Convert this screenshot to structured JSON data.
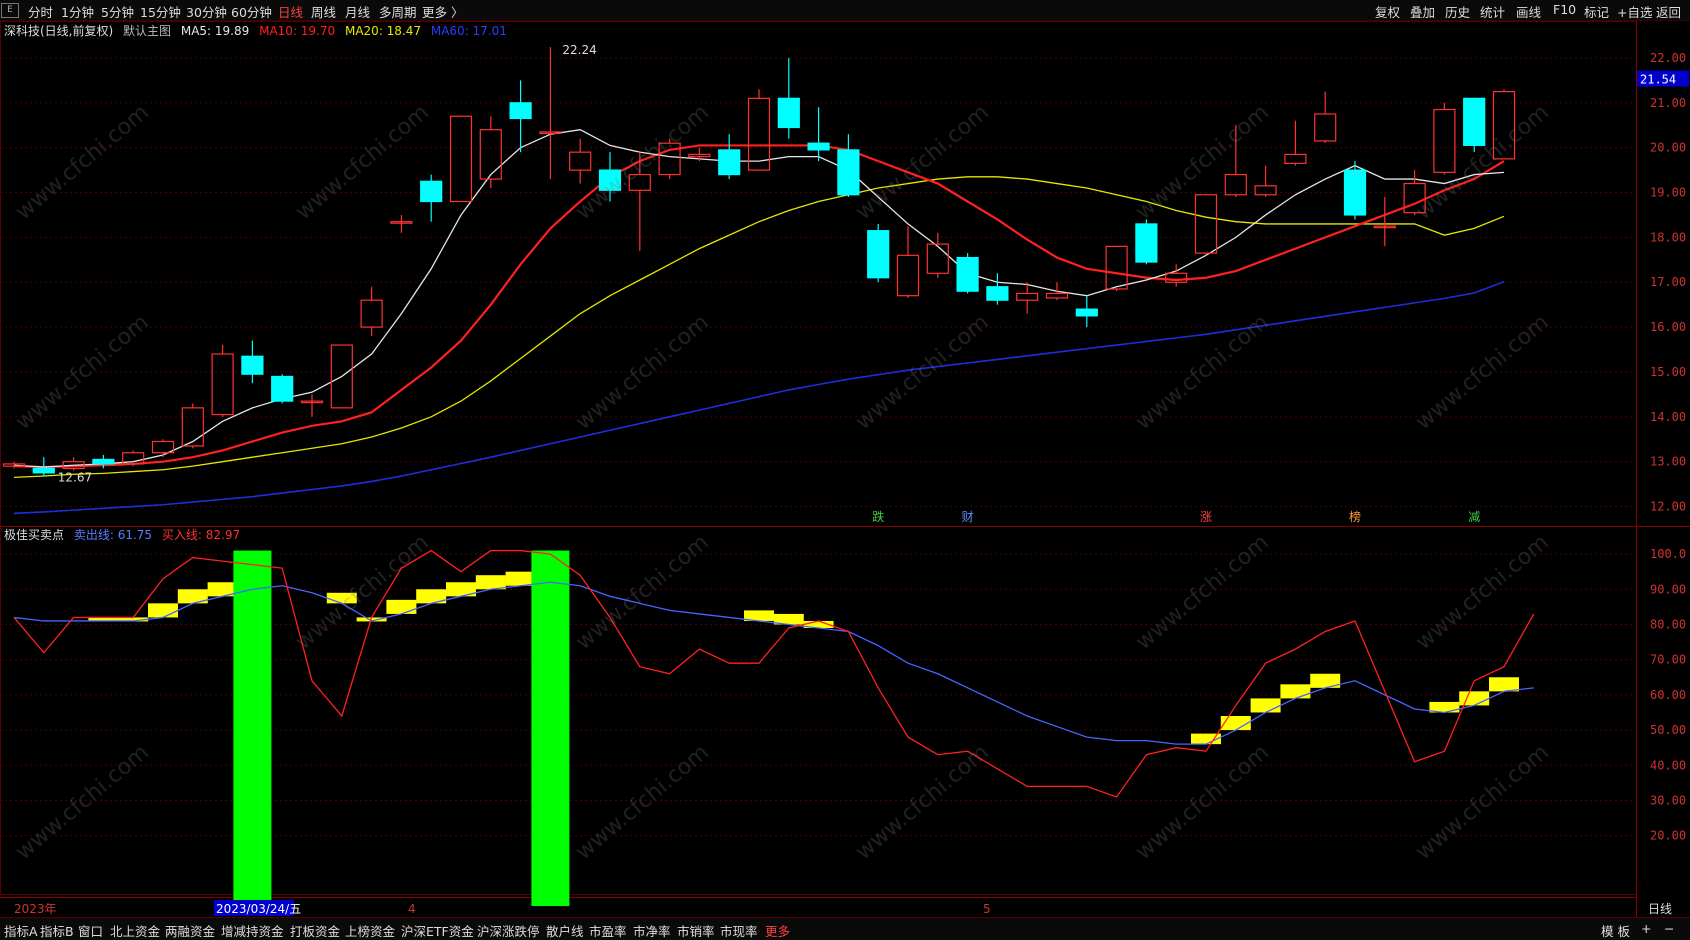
{
  "toolbar": {
    "system_icon": "E",
    "periods": [
      "分时",
      "1分钟",
      "5分钟",
      "15分钟",
      "30分钟",
      "60分钟",
      "日线",
      "周线",
      "月线",
      "多周期",
      "更多 〉"
    ],
    "active_period": "日线",
    "right_tools": [
      "复权",
      "叠加",
      "历史",
      "统计",
      "画线",
      "F10",
      "标记",
      "+自选",
      "返回"
    ]
  },
  "main_legend": {
    "title": "深科技(日线,前复权)",
    "indicator_name": "默认主图",
    "ma5": "MA5: 19.89",
    "ma10": "MA10: 19.70",
    "ma20": "MA20: 18.47",
    "ma60": "MA60: 17.01"
  },
  "sub_legend": {
    "name": "极佳买卖点",
    "sell_line": "卖出线: 61.75",
    "buy_line": "买入线: 82.97"
  },
  "price_axis": [
    "22.00",
    "21.00",
    "20.00",
    "19.00",
    "18.00",
    "17.00",
    "16.00",
    "15.00",
    "14.00",
    "13.00",
    "12.00"
  ],
  "current_price": "21.54",
  "high_label": "22.24",
  "low_label": "12.67",
  "sub_axis": [
    "100.0",
    "90.00",
    "80.00",
    "70.00",
    "60.00",
    "50.00",
    "40.00",
    "30.00",
    "20.00"
  ],
  "markers": [
    "跌",
    "财",
    "涨",
    "榜",
    "减"
  ],
  "date_axis": {
    "year": "2023年",
    "cursor": "2023/03/24/五",
    "apr": "4",
    "may": "5",
    "period": "日线"
  },
  "colors": {
    "up": "#ff3232",
    "down": "#00ffff",
    "ma5": "#e6e6e6",
    "ma10": "#ff2020",
    "ma20": "#e6e600",
    "ma60": "#1e2edc",
    "buy_bar": "#00ff00",
    "signal": "#ffff00"
  },
  "chart_data": {
    "type": "candlestick",
    "candles": [
      {
        "o": 12.9,
        "c": 12.95,
        "h": 13.0,
        "l": 12.85
      },
      {
        "o": 12.85,
        "c": 12.75,
        "h": 13.1,
        "l": 12.67
      },
      {
        "o": 12.85,
        "c": 13.0,
        "h": 13.1,
        "l": 12.8
      },
      {
        "o": 13.05,
        "c": 12.95,
        "h": 13.15,
        "l": 12.85
      },
      {
        "o": 12.95,
        "c": 13.2,
        "h": 13.25,
        "l": 12.9
      },
      {
        "o": 13.2,
        "c": 13.45,
        "h": 13.5,
        "l": 13.1
      },
      {
        "o": 13.35,
        "c": 14.2,
        "h": 14.3,
        "l": 13.3
      },
      {
        "o": 14.05,
        "c": 15.4,
        "h": 15.6,
        "l": 14.0
      },
      {
        "o": 15.35,
        "c": 14.95,
        "h": 15.7,
        "l": 14.75
      },
      {
        "o": 14.9,
        "c": 14.35,
        "h": 14.95,
        "l": 14.3
      },
      {
        "o": 14.35,
        "c": 14.35,
        "h": 14.5,
        "l": 14.0
      },
      {
        "o": 14.2,
        "c": 15.6,
        "h": 15.6,
        "l": 14.2
      },
      {
        "o": 16.0,
        "c": 16.6,
        "h": 16.9,
        "l": 15.8
      },
      {
        "o": 18.35,
        "c": 18.35,
        "h": 18.5,
        "l": 18.1
      },
      {
        "o": 19.25,
        "c": 18.8,
        "h": 19.4,
        "l": 18.35
      },
      {
        "o": 18.8,
        "c": 20.7,
        "h": 20.7,
        "l": 18.8
      },
      {
        "o": 19.3,
        "c": 20.4,
        "h": 20.7,
        "l": 19.1
      },
      {
        "o": 21.0,
        "c": 20.65,
        "h": 21.5,
        "l": 19.9
      },
      {
        "o": 20.35,
        "c": 20.35,
        "h": 22.24,
        "l": 19.3
      },
      {
        "o": 19.5,
        "c": 19.9,
        "h": 20.2,
        "l": 19.2
      },
      {
        "o": 19.5,
        "c": 19.05,
        "h": 19.9,
        "l": 18.8
      },
      {
        "o": 19.05,
        "c": 19.4,
        "h": 19.9,
        "l": 17.7
      },
      {
        "o": 19.4,
        "c": 20.1,
        "h": 20.2,
        "l": 19.3
      },
      {
        "o": 19.8,
        "c": 19.85,
        "h": 20.0,
        "l": 19.7
      },
      {
        "o": 19.95,
        "c": 19.4,
        "h": 20.3,
        "l": 19.3
      },
      {
        "o": 19.5,
        "c": 21.1,
        "h": 21.3,
        "l": 19.5
      },
      {
        "o": 21.1,
        "c": 20.45,
        "h": 22.0,
        "l": 20.2
      },
      {
        "o": 20.1,
        "c": 19.95,
        "h": 20.9,
        "l": 19.7
      },
      {
        "o": 19.95,
        "c": 18.95,
        "h": 20.3,
        "l": 18.9
      },
      {
        "o": 18.15,
        "c": 17.1,
        "h": 18.3,
        "l": 17.0
      },
      {
        "o": 16.7,
        "c": 17.6,
        "h": 18.25,
        "l": 16.65
      },
      {
        "o": 17.2,
        "c": 17.85,
        "h": 18.1,
        "l": 17.1
      },
      {
        "o": 17.55,
        "c": 16.8,
        "h": 17.65,
        "l": 16.75
      },
      {
        "o": 16.9,
        "c": 16.6,
        "h": 17.2,
        "l": 16.5
      },
      {
        "o": 16.6,
        "c": 16.75,
        "h": 17.0,
        "l": 16.3
      },
      {
        "o": 16.65,
        "c": 16.75,
        "h": 17.0,
        "l": 16.6
      },
      {
        "o": 16.4,
        "c": 16.25,
        "h": 16.7,
        "l": 16.0
      },
      {
        "o": 16.85,
        "c": 17.8,
        "h": 17.8,
        "l": 16.8
      },
      {
        "o": 18.3,
        "c": 17.45,
        "h": 18.4,
        "l": 17.4
      },
      {
        "o": 17.0,
        "c": 17.2,
        "h": 17.4,
        "l": 16.9
      },
      {
        "o": 17.65,
        "c": 18.95,
        "h": 18.95,
        "l": 17.6
      },
      {
        "o": 18.95,
        "c": 19.4,
        "h": 20.5,
        "l": 18.9
      },
      {
        "o": 18.95,
        "c": 19.15,
        "h": 19.6,
        "l": 18.9
      },
      {
        "o": 19.65,
        "c": 19.85,
        "h": 20.6,
        "l": 19.6
      },
      {
        "o": 20.15,
        "c": 20.75,
        "h": 21.25,
        "l": 20.1
      },
      {
        "o": 19.5,
        "c": 18.5,
        "h": 19.7,
        "l": 18.4
      },
      {
        "o": 18.25,
        "c": 18.25,
        "h": 18.9,
        "l": 17.8
      },
      {
        "o": 18.55,
        "c": 19.2,
        "h": 19.5,
        "l": 18.5
      },
      {
        "o": 19.45,
        "c": 20.85,
        "h": 21.0,
        "l": 19.4
      },
      {
        "o": 21.1,
        "c": 20.05,
        "h": 21.1,
        "l": 19.9
      },
      {
        "o": 19.75,
        "c": 21.25,
        "h": 21.3,
        "l": 19.75
      }
    ],
    "ma5": [
      12.92,
      12.88,
      12.92,
      12.95,
      13.0,
      13.15,
      13.45,
      13.9,
      14.2,
      14.4,
      14.55,
      14.9,
      15.4,
      16.3,
      17.3,
      18.5,
      19.4,
      20.0,
      20.3,
      20.4,
      20.05,
      19.9,
      19.8,
      19.75,
      19.7,
      19.7,
      19.8,
      19.8,
      19.5,
      18.9,
      18.3,
      17.8,
      17.2,
      17.0,
      16.95,
      16.8,
      16.7,
      16.9,
      17.05,
      17.25,
      17.6,
      18.0,
      18.5,
      18.95,
      19.3,
      19.6,
      19.3,
      19.3,
      19.2,
      19.4,
      19.45
    ],
    "ma10": [
      12.9,
      12.88,
      12.9,
      12.92,
      12.95,
      13.0,
      13.1,
      13.25,
      13.45,
      13.65,
      13.8,
      13.9,
      14.1,
      14.6,
      15.1,
      15.7,
      16.5,
      17.4,
      18.2,
      18.8,
      19.35,
      19.7,
      19.95,
      20.05,
      20.05,
      20.05,
      20.05,
      20.05,
      19.95,
      19.7,
      19.45,
      19.2,
      18.8,
      18.4,
      17.95,
      17.55,
      17.3,
      17.2,
      17.1,
      17.05,
      17.1,
      17.25,
      17.5,
      17.75,
      18.0,
      18.25,
      18.5,
      18.75,
      19.05,
      19.3,
      19.7
    ],
    "ma20": [
      12.65,
      12.68,
      12.72,
      12.74,
      12.78,
      12.82,
      12.9,
      13.0,
      13.1,
      13.2,
      13.3,
      13.4,
      13.55,
      13.75,
      14.0,
      14.35,
      14.8,
      15.3,
      15.8,
      16.3,
      16.7,
      17.05,
      17.4,
      17.75,
      18.05,
      18.35,
      18.6,
      18.8,
      18.95,
      19.1,
      19.2,
      19.3,
      19.35,
      19.35,
      19.3,
      19.2,
      19.1,
      18.95,
      18.8,
      18.6,
      18.45,
      18.35,
      18.3,
      18.3,
      18.3,
      18.3,
      18.3,
      18.3,
      18.05,
      18.2,
      18.47
    ],
    "ma60": [
      11.85,
      11.88,
      11.92,
      11.96,
      12.0,
      12.04,
      12.1,
      12.16,
      12.22,
      12.3,
      12.38,
      12.46,
      12.56,
      12.68,
      12.82,
      12.96,
      13.1,
      13.25,
      13.4,
      13.55,
      13.7,
      13.85,
      14.0,
      14.15,
      14.3,
      14.45,
      14.6,
      14.72,
      14.84,
      14.94,
      15.04,
      15.12,
      15.2,
      15.28,
      15.36,
      15.44,
      15.52,
      15.6,
      15.68,
      15.76,
      15.84,
      15.94,
      16.04,
      16.14,
      16.24,
      16.34,
      16.44,
      16.54,
      16.64,
      16.76,
      17.01
    ],
    "buy_line": [
      82,
      72,
      82,
      82,
      82,
      93,
      99,
      98,
      97,
      96,
      64,
      54,
      82,
      96,
      101,
      95,
      101,
      101,
      100,
      94,
      82,
      68,
      66,
      73,
      69,
      69,
      79,
      81,
      78,
      62,
      48,
      43,
      44,
      39,
      34,
      34,
      34,
      31,
      43,
      45,
      44,
      57,
      69,
      73,
      78,
      81,
      61,
      41,
      44,
      64,
      68,
      83
    ],
    "sell_line": [
      82,
      81,
      81,
      81,
      81,
      82,
      86,
      88,
      90,
      91,
      89,
      86,
      81,
      83,
      86,
      88,
      90,
      91,
      92,
      91,
      88,
      86,
      84,
      83,
      82,
      81,
      80,
      79,
      78,
      74,
      69,
      66,
      62,
      58,
      54,
      51,
      48,
      47,
      47,
      46,
      46,
      50,
      55,
      59,
      62,
      64,
      60,
      56,
      55,
      57,
      61,
      62
    ],
    "buy_signals": [
      8,
      18
    ],
    "sell_signal_ranges": [
      [
        3,
        7
      ],
      [
        11,
        17
      ],
      [
        25,
        27
      ],
      [
        40,
        44
      ],
      [
        48,
        50
      ]
    ]
  }
}
